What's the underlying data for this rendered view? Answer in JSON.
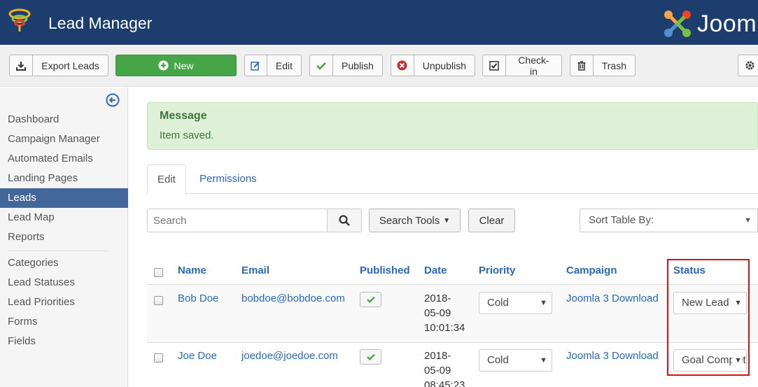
{
  "header": {
    "title": "Lead Manager",
    "brand": "Joom"
  },
  "toolbar": {
    "export": "Export Leads",
    "new": "New",
    "edit": "Edit",
    "publish": "Publish",
    "unpublish": "Unpublish",
    "checkin": "Check-in",
    "trash": "Trash"
  },
  "sidebar": {
    "items": [
      {
        "label": "Dashboard"
      },
      {
        "label": "Campaign Manager"
      },
      {
        "label": "Automated Emails"
      },
      {
        "label": "Landing Pages"
      },
      {
        "label": "Leads"
      },
      {
        "label": "Lead Map"
      },
      {
        "label": "Reports"
      },
      {
        "label": "Categories"
      },
      {
        "label": "Lead Statuses"
      },
      {
        "label": "Lead Priorities"
      },
      {
        "label": "Forms"
      },
      {
        "label": "Fields"
      }
    ],
    "active": "Leads"
  },
  "message": {
    "heading": "Message",
    "text": "Item saved."
  },
  "tabs": [
    {
      "label": "Edit"
    },
    {
      "label": "Permissions"
    }
  ],
  "filters": {
    "search_placeholder": "Search",
    "search_tools": "Search Tools",
    "clear": "Clear",
    "sort_by": "Sort Table By:"
  },
  "table": {
    "columns": [
      "Name",
      "Email",
      "Published",
      "Date",
      "Priority",
      "Campaign",
      "Status"
    ],
    "rows": [
      {
        "name": "Bob Doe",
        "email": "bobdoe@bobdoe.com",
        "date1": "2018-",
        "date2": "05-09",
        "date3": "10:01:34",
        "priority": "Cold",
        "campaign": "Joomla 3 Download",
        "status": "New Lead"
      },
      {
        "name": "Joe Doe",
        "email": "joedoe@joedoe.com",
        "date1": "2018-",
        "date2": "05-09",
        "date3": "08:45:23",
        "priority": "Cold",
        "campaign": "Joomla 3 Download",
        "status": "Goal Completed"
      }
    ]
  },
  "colors": {
    "header_bg": "#1c3d6e",
    "new_button": "#46a546",
    "active_sidebar": "#44679a",
    "link": "#2a69b8",
    "highlight": "#d9120f"
  }
}
